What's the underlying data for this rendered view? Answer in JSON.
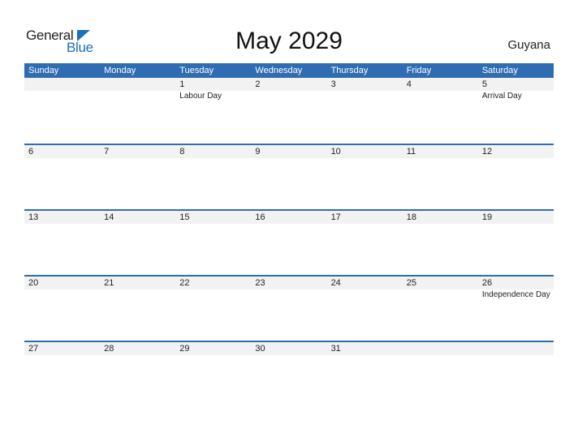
{
  "logo": {
    "part1": "General",
    "part2": "Blue"
  },
  "title": "May 2029",
  "country": "Guyana",
  "colors": {
    "accent": "#2e6db2",
    "day_bar": "#f2f2f2"
  },
  "weekdays": [
    "Sunday",
    "Monday",
    "Tuesday",
    "Wednesday",
    "Thursday",
    "Friday",
    "Saturday"
  ],
  "weeks": [
    {
      "days": [
        "",
        "",
        "1",
        "2",
        "3",
        "4",
        "5"
      ],
      "events": [
        "",
        "",
        "Labour Day",
        "",
        "",
        "",
        "Arrival Day"
      ]
    },
    {
      "days": [
        "6",
        "7",
        "8",
        "9",
        "10",
        "11",
        "12"
      ],
      "events": [
        "",
        "",
        "",
        "",
        "",
        "",
        ""
      ]
    },
    {
      "days": [
        "13",
        "14",
        "15",
        "16",
        "17",
        "18",
        "19"
      ],
      "events": [
        "",
        "",
        "",
        "",
        "",
        "",
        ""
      ]
    },
    {
      "days": [
        "20",
        "21",
        "22",
        "23",
        "24",
        "25",
        "26"
      ],
      "events": [
        "",
        "",
        "",
        "",
        "",
        "",
        "Independence Day"
      ]
    },
    {
      "days": [
        "27",
        "28",
        "29",
        "30",
        "31",
        "",
        ""
      ],
      "events": [
        "",
        "",
        "",
        "",
        "",
        "",
        ""
      ]
    }
  ]
}
